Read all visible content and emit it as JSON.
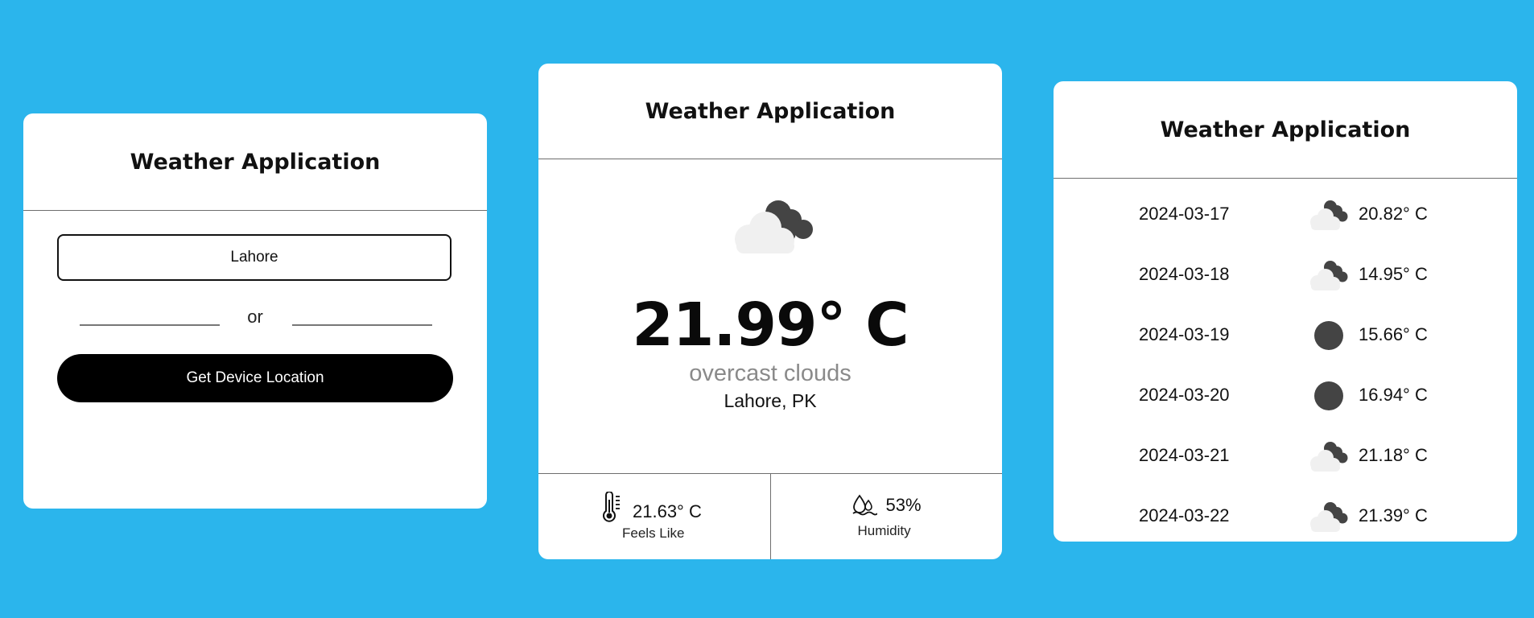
{
  "search_card": {
    "title": "Weather Application",
    "city_input_value": "Lahore",
    "or_text": "or",
    "device_location_label": "Get Device Location"
  },
  "current_card": {
    "title": "Weather Application",
    "icon": "broken-clouds-icon",
    "temperature": "21.99° C",
    "description": "overcast clouds",
    "location": "Lahore, PK",
    "feels_like_value": "21.63° C",
    "feels_like_label": "Feels Like",
    "humidity_value": "53%",
    "humidity_label": "Humidity"
  },
  "forecast_card": {
    "title": "Weather Application",
    "days": [
      {
        "date": "2024-03-17",
        "icon": "broken-clouds-icon",
        "temp": "20.82° C"
      },
      {
        "date": "2024-03-18",
        "icon": "broken-clouds-icon",
        "temp": "14.95° C"
      },
      {
        "date": "2024-03-19",
        "icon": "dark-circle-icon",
        "temp": "15.66° C"
      },
      {
        "date": "2024-03-20",
        "icon": "dark-circle-icon",
        "temp": "16.94° C"
      },
      {
        "date": "2024-03-21",
        "icon": "broken-clouds-icon",
        "temp": "21.18° C"
      },
      {
        "date": "2024-03-22",
        "icon": "broken-clouds-icon",
        "temp": "21.39° C"
      }
    ]
  },
  "colors": {
    "background": "#2bb5ec",
    "card": "#ffffff",
    "button": "#000000",
    "cloud_light": "#f0f0f0",
    "cloud_dark": "#444444"
  }
}
